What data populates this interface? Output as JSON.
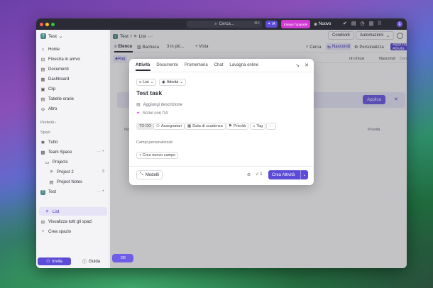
{
  "topbar": {
    "search_placeholder": "Cerca...",
    "shortcut": "⌘J",
    "ia_label": "IA",
    "upgrade_label": "Esegui l'upgrade",
    "new_label": "Nuovo",
    "avatar_initial": "L"
  },
  "sidebar": {
    "workspace": "Test",
    "workspace_initial": "T",
    "items": [
      {
        "label": "Home"
      },
      {
        "label": "Finestra in arrivo"
      },
      {
        "label": "Documenti"
      },
      {
        "label": "Dashboard"
      },
      {
        "label": "Clip"
      },
      {
        "label": "Tabelle orarie"
      },
      {
        "label": "Altro"
      }
    ],
    "favorites_label": "Preferiti",
    "spaces_label": "Spazi",
    "spaces": [
      {
        "label": "Tutto"
      },
      {
        "label": "Team Space"
      },
      {
        "label": "Projects"
      },
      {
        "label": "Project 2",
        "count": "3"
      },
      {
        "label": "Project Notes"
      },
      {
        "label": "Test",
        "initial": "T"
      },
      {
        "label": "List"
      },
      {
        "label": "Visualizza tutti gli spazi"
      },
      {
        "label": "Crea spazio"
      }
    ],
    "invite_label": "Invita",
    "help_label": "Guida"
  },
  "main": {
    "breadcrumb": {
      "space": "Test",
      "list": "List"
    },
    "share_label": "Condividi",
    "automations_label": "Automazioni",
    "views": [
      {
        "label": "Elenco"
      },
      {
        "label": "Bacheca"
      },
      {
        "label": "3 in più..."
      },
      {
        "label": "+ Vista"
      }
    ],
    "search_label": "Cerca",
    "hide_label": "Nascondi",
    "customize_label": "Personalizza",
    "add_task_label": "Aggiungi Attività",
    "filter_chip": "Rag",
    "closed_label": "nti chiusi",
    "hide2_label": "Nascondi",
    "search_tasks_placeholder": "Cerca tra le attiv",
    "apply_label": "Applica",
    "col_priority": "Priorità",
    "col_name": "No",
    "fab_count": "2/6"
  },
  "modal": {
    "tabs": [
      "Attività",
      "Documento",
      "Promemoria",
      "Chat",
      "Lavagna online"
    ],
    "list_chip": "List",
    "type_chip": "Attività",
    "title": "Test task",
    "add_description": "Aggiungi descrizione",
    "write_ai": "Scrivi con l'IA",
    "props": [
      {
        "label": "TO DO"
      },
      {
        "label": "Assegnatari"
      },
      {
        "label": "Data di scadenza"
      },
      {
        "label": "Priorità"
      },
      {
        "label": "Tag"
      },
      {
        "label": "···"
      }
    ],
    "custom_fields_label": "Campi personalizzati",
    "new_field_label": "+ Crea nuovo campo",
    "models_label": "Modelli",
    "notif_count": "1",
    "create_label": "Crea Attività"
  }
}
